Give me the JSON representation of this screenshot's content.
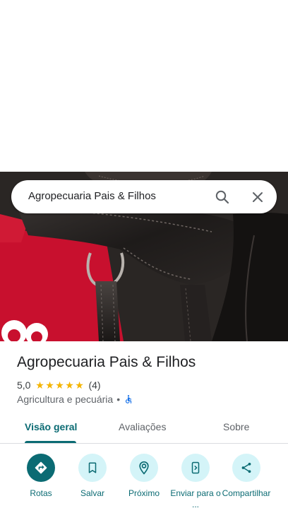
{
  "search": {
    "query": "Agropecuaria Pais & Filhos",
    "search_icon": "search-icon",
    "close_icon": "close-icon"
  },
  "place": {
    "name": "Agropecuaria Pais & Filhos",
    "rating": "5,0",
    "stars": 5,
    "review_count": "(4)",
    "category": "Agricultura e pecuária",
    "separator": "•",
    "accessibility_icon": "wheelchair-icon"
  },
  "tabs": {
    "overview": "Visão geral",
    "reviews": "Avaliações",
    "about": "Sobre",
    "active": "overview"
  },
  "actions": {
    "directions": {
      "label": "Rotas",
      "icon": "directions-icon"
    },
    "save": {
      "label": "Salvar",
      "icon": "bookmark-icon"
    },
    "nearby": {
      "label": "Próximo",
      "icon": "nearby-pin-icon"
    },
    "send_to_phone": {
      "label": "Enviar para o ...",
      "icon": "send-to-phone-icon"
    },
    "share": {
      "label": "Compartilhar",
      "icon": "share-icon"
    }
  },
  "colors": {
    "accent": "#0b6b73",
    "accent_light": "#d4f4f8",
    "star": "#f4b400",
    "text_primary": "#202124",
    "text_secondary": "#5f6368"
  }
}
